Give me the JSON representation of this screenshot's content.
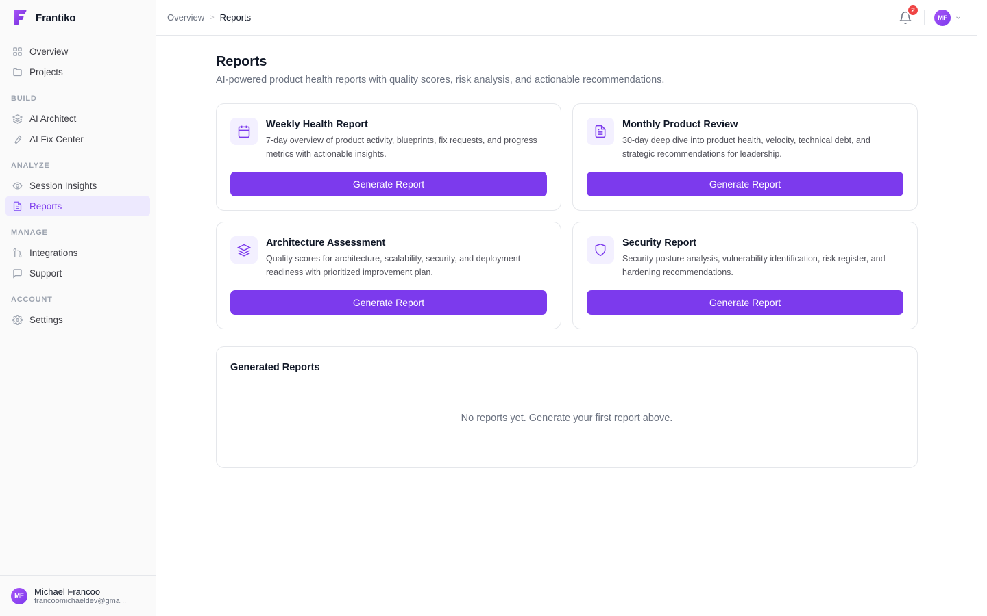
{
  "brand": {
    "name": "Frantiko"
  },
  "sidebar": {
    "top_items": [
      {
        "label": "Overview",
        "icon": "grid-icon"
      },
      {
        "label": "Projects",
        "icon": "folder-icon"
      }
    ],
    "sections": [
      {
        "title": "BUILD",
        "items": [
          {
            "label": "AI Architect",
            "icon": "layers-icon"
          },
          {
            "label": "AI Fix Center",
            "icon": "wrench-icon"
          }
        ]
      },
      {
        "title": "ANALYZE",
        "items": [
          {
            "label": "Session Insights",
            "icon": "eye-icon"
          },
          {
            "label": "Reports",
            "icon": "file-text-icon",
            "active": true
          }
        ]
      },
      {
        "title": "MANAGE",
        "items": [
          {
            "label": "Integrations",
            "icon": "git-icon"
          },
          {
            "label": "Support",
            "icon": "message-icon"
          }
        ]
      },
      {
        "title": "ACCOUNT",
        "items": [
          {
            "label": "Settings",
            "icon": "gear-icon"
          }
        ]
      }
    ],
    "user": {
      "initials": "MF",
      "name": "Michael Francoo",
      "email": "francoomichaeldev@gma..."
    }
  },
  "header": {
    "breadcrumb": [
      "Overview",
      "Reports"
    ],
    "notifications_count": "2",
    "avatar_initials": "MF"
  },
  "page": {
    "title": "Reports",
    "subtitle": "AI-powered product health reports with quality scores, risk analysis, and actionable recommendations."
  },
  "reports": [
    {
      "title": "Weekly Health Report",
      "desc": "7-day overview of product activity, blueprints, fix requests, and progress metrics with actionable insights.",
      "icon": "calendar-icon",
      "button": "Generate Report"
    },
    {
      "title": "Monthly Product Review",
      "desc": "30-day deep dive into product health, velocity, technical debt, and strategic recommendations for leadership.",
      "icon": "file-text-icon",
      "button": "Generate Report"
    },
    {
      "title": "Architecture Assessment",
      "desc": "Quality scores for architecture, scalability, security, and deployment readiness with prioritized improvement plan.",
      "icon": "layers-icon",
      "button": "Generate Report"
    },
    {
      "title": "Security Report",
      "desc": "Security posture analysis, vulnerability identification, risk register, and hardening recommendations.",
      "icon": "shield-icon",
      "button": "Generate Report"
    }
  ],
  "generated": {
    "title": "Generated Reports",
    "empty_text": "No reports yet. Generate your first report above."
  },
  "colors": {
    "accent": "#7c3aed",
    "active_bg": "#ede9fe",
    "badge": "#ef4444"
  }
}
